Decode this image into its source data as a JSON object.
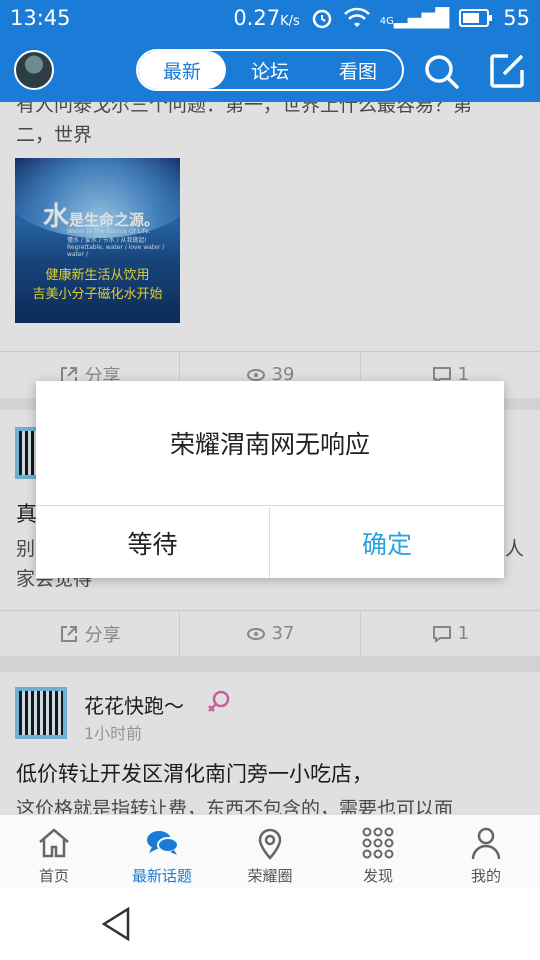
{
  "status_bar": {
    "time": "13:45",
    "data_rate": "0.27",
    "data_rate_unit": "K/s",
    "network": "4G",
    "battery": "55"
  },
  "header": {
    "tabs": [
      {
        "label": "最新",
        "active": true
      },
      {
        "label": "论坛",
        "active": false
      },
      {
        "label": "看图",
        "active": false
      }
    ],
    "search_icon": "search-icon",
    "compose_icon": "compose-icon"
  },
  "feed": {
    "post1": {
      "text_partial_top": "有人问泰戈尔三个问题：第一，世界上什么最容易？第",
      "text_line2": "二，世界",
      "image": {
        "big_char": "水",
        "title": "是生命之源。",
        "subtitle_en": "Water Is The Source Of Life.",
        "subtitle_cn": "懂水 / 爱水 / 节水 / 从我做起!",
        "subtitle_en2": "Regrettable, water / love water / water /",
        "line1": "健康新生活从饮用",
        "line2": "吉美小分子磁化水开始"
      },
      "share_label": "分享",
      "views": "39",
      "comments": "1"
    },
    "post2": {
      "title_partial": "真",
      "text_partial_left": "别",
      "text_partial_right": "人",
      "text_line2": "家会觉得",
      "share_label": "分享",
      "views": "37",
      "comments": "1"
    },
    "post3": {
      "author": "花花快跑～",
      "time": "1小时前",
      "title": "低价转让开发区渭化南门旁一小吃店，",
      "text": "这价格就是指转让费，东西不包含的，需要也可以面"
    }
  },
  "dialog": {
    "message": "荣耀渭南网无响应",
    "wait_label": "等待",
    "ok_label": "确定"
  },
  "bottom_nav": [
    {
      "label": "首页",
      "icon": "home-icon",
      "active": false
    },
    {
      "label": "最新话题",
      "icon": "chat-icon",
      "active": true
    },
    {
      "label": "荣耀圈",
      "icon": "location-icon",
      "active": false
    },
    {
      "label": "发现",
      "icon": "grid-icon",
      "active": false
    },
    {
      "label": "我的",
      "icon": "user-icon",
      "active": false
    }
  ],
  "colors": {
    "primary": "#1a7cd6",
    "accent": "#2aa3e0",
    "female": "#e06bb2"
  }
}
